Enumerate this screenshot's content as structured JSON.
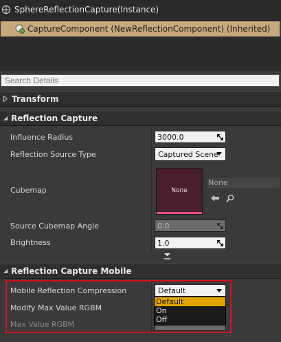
{
  "instance": {
    "label": "SphereReflectionCapture(Instance)"
  },
  "component": {
    "label": "CaptureComponent (NewReflectionComponent) (Inherited)"
  },
  "search": {
    "placeholder": "Search Details"
  },
  "categories": {
    "transform": "Transform",
    "reflection_capture": "Reflection Capture",
    "reflection_capture_mobile": "Reflection Capture Mobile"
  },
  "reflection_capture": {
    "influence_radius": {
      "label": "Influence Radius",
      "value": "3000.0"
    },
    "source_type": {
      "label": "Reflection Source Type",
      "value": "Captured Scene"
    },
    "cubemap": {
      "label": "Cubemap",
      "thumb_text": "None",
      "asset_text": "None"
    },
    "source_cubemap_angle": {
      "label": "Source Cubemap Angle",
      "value": "0.0"
    },
    "brightness": {
      "label": "Brightness",
      "value": "1.0"
    }
  },
  "mobile": {
    "compression": {
      "label": "Mobile Reflection Compression",
      "value": "Default",
      "options": [
        "Default",
        "On",
        "Off"
      ],
      "selected_index": 0
    },
    "modify_max_value": {
      "label": "Modify Max Value RGBM"
    },
    "max_value": {
      "label": "Max Value RGBM"
    }
  },
  "colors": {
    "highlight": "#d3131c",
    "selected_option": "#e3a400",
    "component_row": "#c8a97c"
  }
}
